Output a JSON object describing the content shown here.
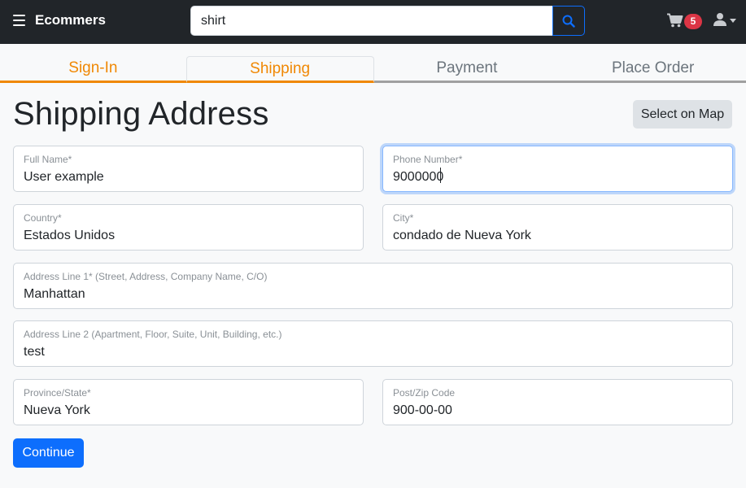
{
  "navbar": {
    "brand": "Ecommers",
    "search_value": "shirt",
    "cart_count": "5"
  },
  "steps": [
    "Sign-In",
    "Shipping",
    "Payment",
    "Place Order"
  ],
  "page": {
    "title": "Shipping Address",
    "map_button": "Select on Map",
    "continue_button": "Continue"
  },
  "fields": {
    "full_name": {
      "label": "Full Name*",
      "value": "User example"
    },
    "phone": {
      "label": "Phone Number*",
      "value": "9000000"
    },
    "country": {
      "label": "Country*",
      "value": "Estados Unidos"
    },
    "city": {
      "label": "City*",
      "value": "condado de Nueva York"
    },
    "address1": {
      "label": "Address Line 1* (Street, Address, Company Name, C/O)",
      "value": "Manhattan"
    },
    "address2": {
      "label": "Address Line 2 (Apartment, Floor, Suite, Unit, Building, etc.)",
      "value": "test"
    },
    "province": {
      "label": "Province/State*",
      "value": "Nueva York"
    },
    "postal": {
      "label": "Post/Zip Code",
      "value": "900-00-00"
    }
  },
  "colors": {
    "navbar": "#212529",
    "accent": "#f08804",
    "primary": "#0d6efd",
    "badge": "#dc3545"
  },
  "icons": {
    "menu": "hamburger-icon",
    "search": "search-icon",
    "cart": "cart-icon",
    "user": "user-icon"
  }
}
